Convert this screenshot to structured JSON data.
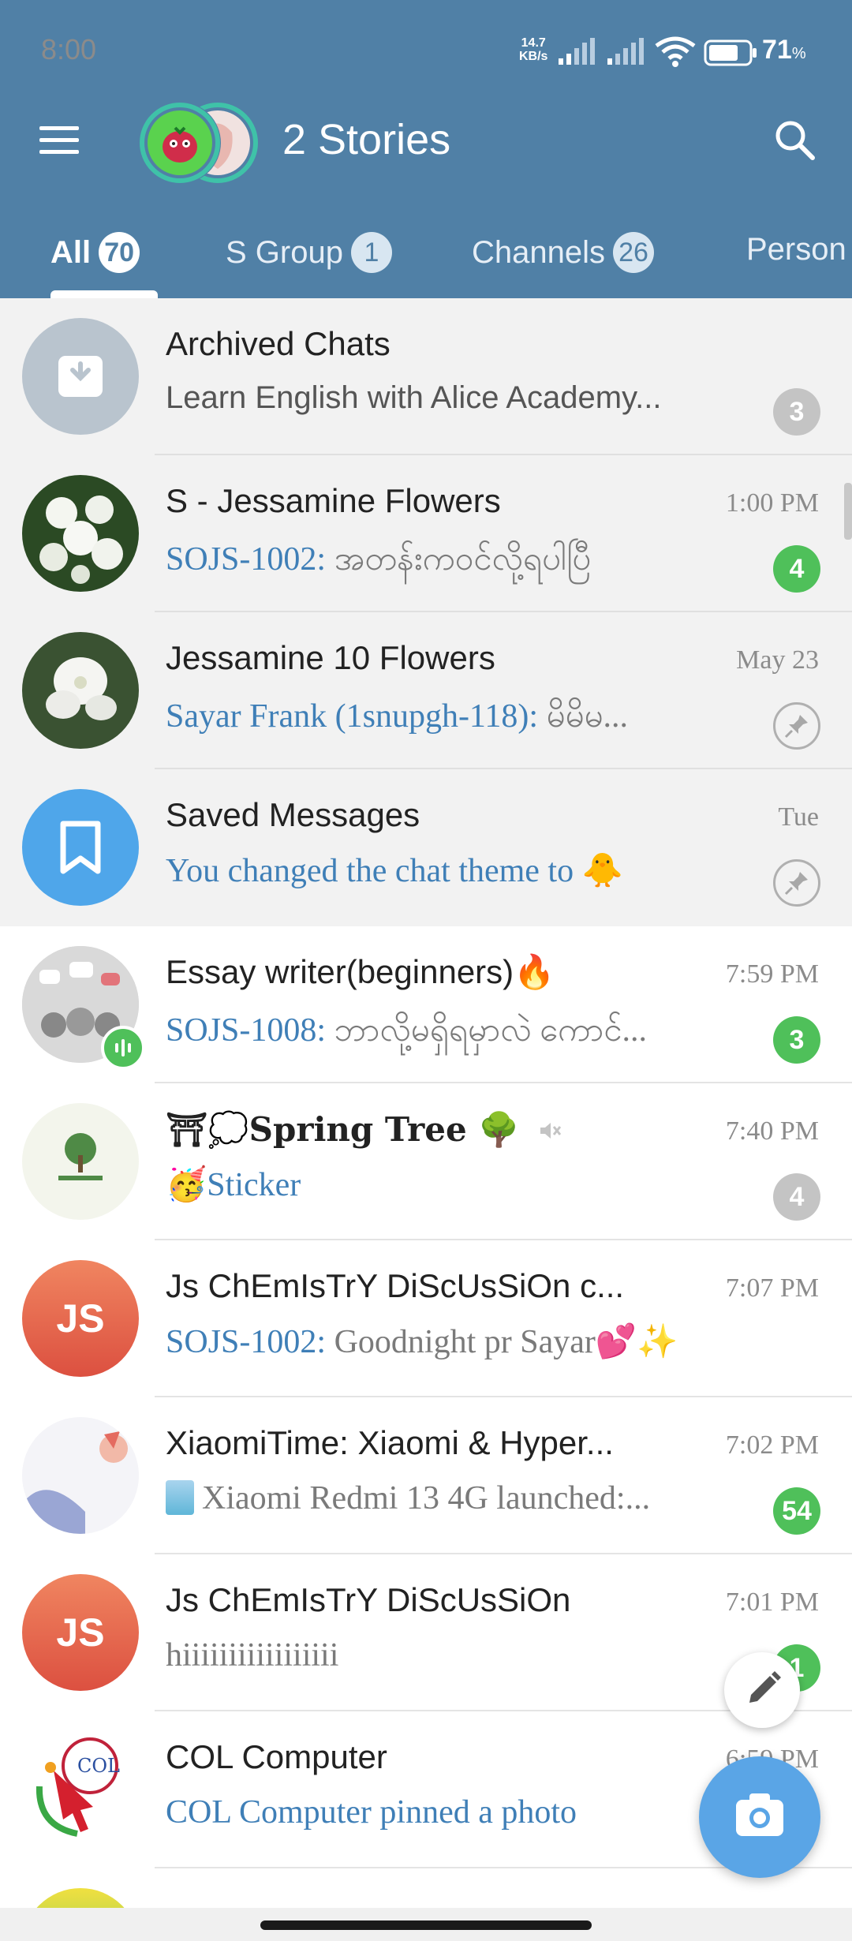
{
  "status_bar": {
    "time": "8:00",
    "speed_value": "14.7",
    "speed_unit": "KB/s",
    "battery_percent": "71",
    "percent_sign": "%"
  },
  "header": {
    "title": "2 Stories"
  },
  "tabs": [
    {
      "label": "All",
      "count": "70",
      "active": true
    },
    {
      "label": "S Group",
      "count": "1"
    },
    {
      "label": "Channels",
      "count": "26"
    },
    {
      "label": "Person",
      "count": ""
    }
  ],
  "chats": [
    {
      "name": "Archived Chats",
      "time": "",
      "sender": "",
      "preview": "Learn English with Alice Academy...",
      "count": "3",
      "count_muted": true
    },
    {
      "name": "S - Jessamine Flowers",
      "time": "1:00 PM",
      "sender": "SOJS-1002:",
      "preview": " အတန်းကဝင်လို့ရပါပြီ",
      "count": "4"
    },
    {
      "name": "Jessamine 10 Flowers",
      "time": "May 23",
      "sender": "Sayar Frank (1snupgh-118):",
      "preview": " မိမိမ...",
      "pinned": true
    },
    {
      "name": "Saved Messages",
      "time": "Tue",
      "sender": "",
      "preview": "You changed the chat theme to 🐥",
      "pinned": true
    },
    {
      "name": "Essay writer(beginners)🔥",
      "time": "7:59 PM",
      "sender": "SOJS-1008:",
      "preview": " ဘာလို့မရှိရမှာလဲ ကောင်...",
      "count": "3"
    },
    {
      "name": "⛩💭Spring Tree 🌳",
      "time": "7:40 PM",
      "sender": "",
      "preview": "🥳Sticker",
      "count": "4",
      "count_muted": true
    },
    {
      "name": "Js ChEmIsTrY DiScUsSiOn c...",
      "time": "7:07 PM",
      "sender": "SOJS-1002:",
      "preview": " Goodnight pr Sayar💕✨",
      "avatar_initials": "JS"
    },
    {
      "name": "XiaomiTime: Xiaomi & Hyper...",
      "time": "7:02 PM",
      "sender": "",
      "preview": "Xiaomi Redmi 13 4G launched:...",
      "count": "54"
    },
    {
      "name": "Js ChEmIsTrY DiScUsSiOn",
      "time": "7:01 PM",
      "sender": "",
      "preview": "hiiiiiiiiiiiiiiiii",
      "count": "1",
      "avatar_initials": "JS"
    },
    {
      "name": "COL Computer",
      "time": "6:59 PM",
      "sender": "",
      "preview": "COL Computer pinned a photo",
      "avatar_text": "COL"
    }
  ],
  "colors": {
    "header_bg": "#5080a6",
    "accent_blue": "#3f7fb7",
    "unread_green": "#4fc05a",
    "muted_gray": "#c4c4c4",
    "fab_blue": "#5aa5e6"
  }
}
